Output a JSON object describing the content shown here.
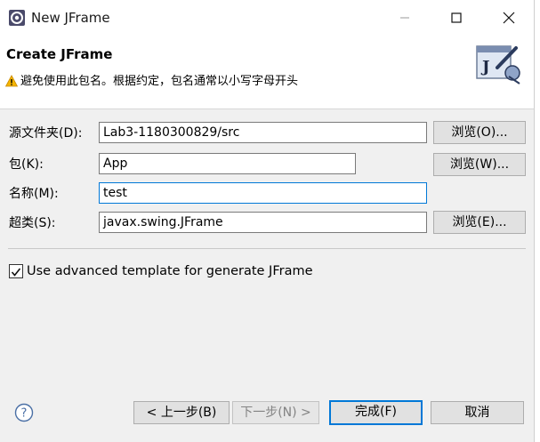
{
  "window": {
    "title": "New JFrame",
    "icon": "eclipse-gear-icon",
    "controls": [
      "minimize-icon",
      "maximize-icon",
      "close-icon"
    ]
  },
  "header": {
    "title": "Create JFrame",
    "warning_icon": "warning-triangle-icon",
    "warning": "避免使用此包名。根据约定，包名通常以小写字母开头",
    "banner_icon": "jframe-wizard-icon"
  },
  "form": {
    "source_folder": {
      "label": "源文件夹(D):",
      "value": "Lab3-1180300829/src",
      "browse": "浏览(O)..."
    },
    "package": {
      "label": "包(K):",
      "value": "App",
      "browse": "浏览(W)..."
    },
    "name": {
      "label": "名称(M):",
      "value": "test"
    },
    "superclass": {
      "label": "超类(S):",
      "value": "javax.swing.JFrame",
      "browse": "浏览(E)..."
    },
    "advanced_template": {
      "label": "Use advanced template for generate JFrame",
      "checked": true
    }
  },
  "footer": {
    "help_icon": "help-icon",
    "back": "< 上一步(B)",
    "next": "下一步(N) >",
    "finish": "完成(F)",
    "cancel": "取消"
  },
  "colors": {
    "accent": "#0078d7",
    "warning": "#f4b400",
    "panel": "#f0f0f0"
  }
}
